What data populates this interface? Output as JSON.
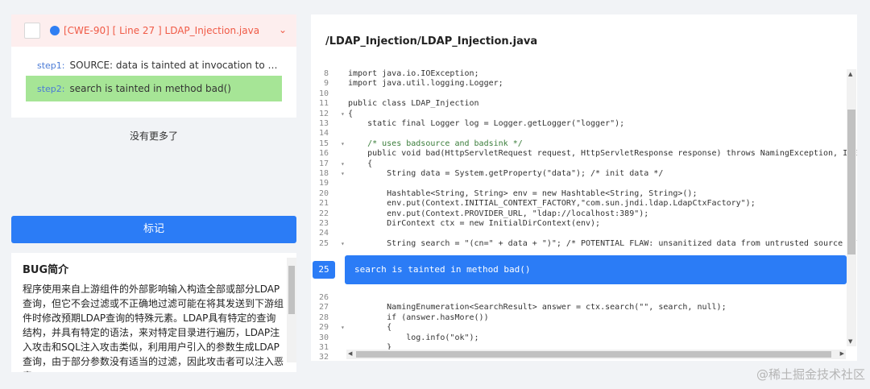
{
  "issue": {
    "title": "[CWE-90] [ Line 27 ] LDAP_Injection.java",
    "steps": [
      {
        "label": "step1:",
        "text": "SOURCE: data is tainted at invocation to < java/l..."
      },
      {
        "label": "step2:",
        "text": "search is tainted in method bad()"
      }
    ]
  },
  "no_more": "没有更多了",
  "mark_button": "标记",
  "bug": {
    "title": "BUG简介",
    "body": "程序使用来自上游组件的外部影响输入构造全部或部分LDAP查询，但它不会过滤或不正确地过滤可能在将其发送到下游组件时修改预期LDAP查询的特殊元素。LDAP具有特定的查询结构，并具有特定的语法，来对特定目录进行遍历，LDAP注入攻击和SQL注入攻击类似，利用用户引入的参数生成LDAP查询，由于部分参数没有适当的过滤，因此攻击者可以注入恶意"
  },
  "editor": {
    "file_path": "/LDAP_Injection/LDAP_Injection.java",
    "lines": [
      {
        "n": "8",
        "fold": "",
        "code": "import java.io.IOException;"
      },
      {
        "n": "9",
        "fold": "",
        "code": "import java.util.logging.Logger;"
      },
      {
        "n": "10",
        "fold": "",
        "code": ""
      },
      {
        "n": "11",
        "fold": "",
        "code": "public class LDAP_Injection"
      },
      {
        "n": "12",
        "fold": "▾",
        "code": "{"
      },
      {
        "n": "13",
        "fold": "",
        "code": "    static final Logger log = Logger.getLogger(\"logger\");"
      },
      {
        "n": "14",
        "fold": "",
        "code": ""
      },
      {
        "n": "15",
        "fold": "▾",
        "code": "    /* uses badsource and badsink */"
      },
      {
        "n": "16",
        "fold": "",
        "code": "    public void bad(HttpServletRequest request, HttpServletResponse response) throws NamingException, IOE"
      },
      {
        "n": "17",
        "fold": "▾",
        "code": "    {"
      },
      {
        "n": "18",
        "fold": "▾",
        "code": "        String data = System.getProperty(\"data\"); /* init data */"
      },
      {
        "n": "19",
        "fold": "",
        "code": ""
      },
      {
        "n": "20",
        "fold": "",
        "code": "        Hashtable<String, String> env = new Hashtable<String, String>();"
      },
      {
        "n": "21",
        "fold": "",
        "code": "        env.put(Context.INITIAL_CONTEXT_FACTORY,\"com.sun.jndi.ldap.LdapCtxFactory\");"
      },
      {
        "n": "22",
        "fold": "",
        "code": "        env.put(Context.PROVIDER_URL, \"ldap://localhost:389\");"
      },
      {
        "n": "23",
        "fold": "",
        "code": "        DirContext ctx = new InitialDirContext(env);"
      },
      {
        "n": "24",
        "fold": "",
        "code": ""
      },
      {
        "n": "25",
        "fold": "▾",
        "code": "        String search = \"(cn=\" + data + \")\"; /* POTENTIAL FLAW: unsanitized data from untrusted source */"
      }
    ],
    "lines_after": [
      {
        "n": "26",
        "fold": "",
        "code": ""
      },
      {
        "n": "27",
        "fold": "",
        "code": "        NamingEnumeration<SearchResult> answer = ctx.search(\"\", search, null);"
      },
      {
        "n": "28",
        "fold": "",
        "code": "        if (answer.hasMore())"
      },
      {
        "n": "29",
        "fold": "▾",
        "code": "        {"
      },
      {
        "n": "30",
        "fold": "",
        "code": "            log.info(\"ok\");"
      },
      {
        "n": "31",
        "fold": "",
        "code": "        }"
      },
      {
        "n": "32",
        "fold": "",
        "code": ""
      }
    ],
    "annotation": {
      "line": "25",
      "text": "search is tainted in method bad()"
    }
  },
  "watermark": "@稀土掘金技术社区",
  "colors": {
    "accent": "#2b7cf6",
    "issue_red": "#f05a46",
    "step_green": "#a6e596"
  }
}
